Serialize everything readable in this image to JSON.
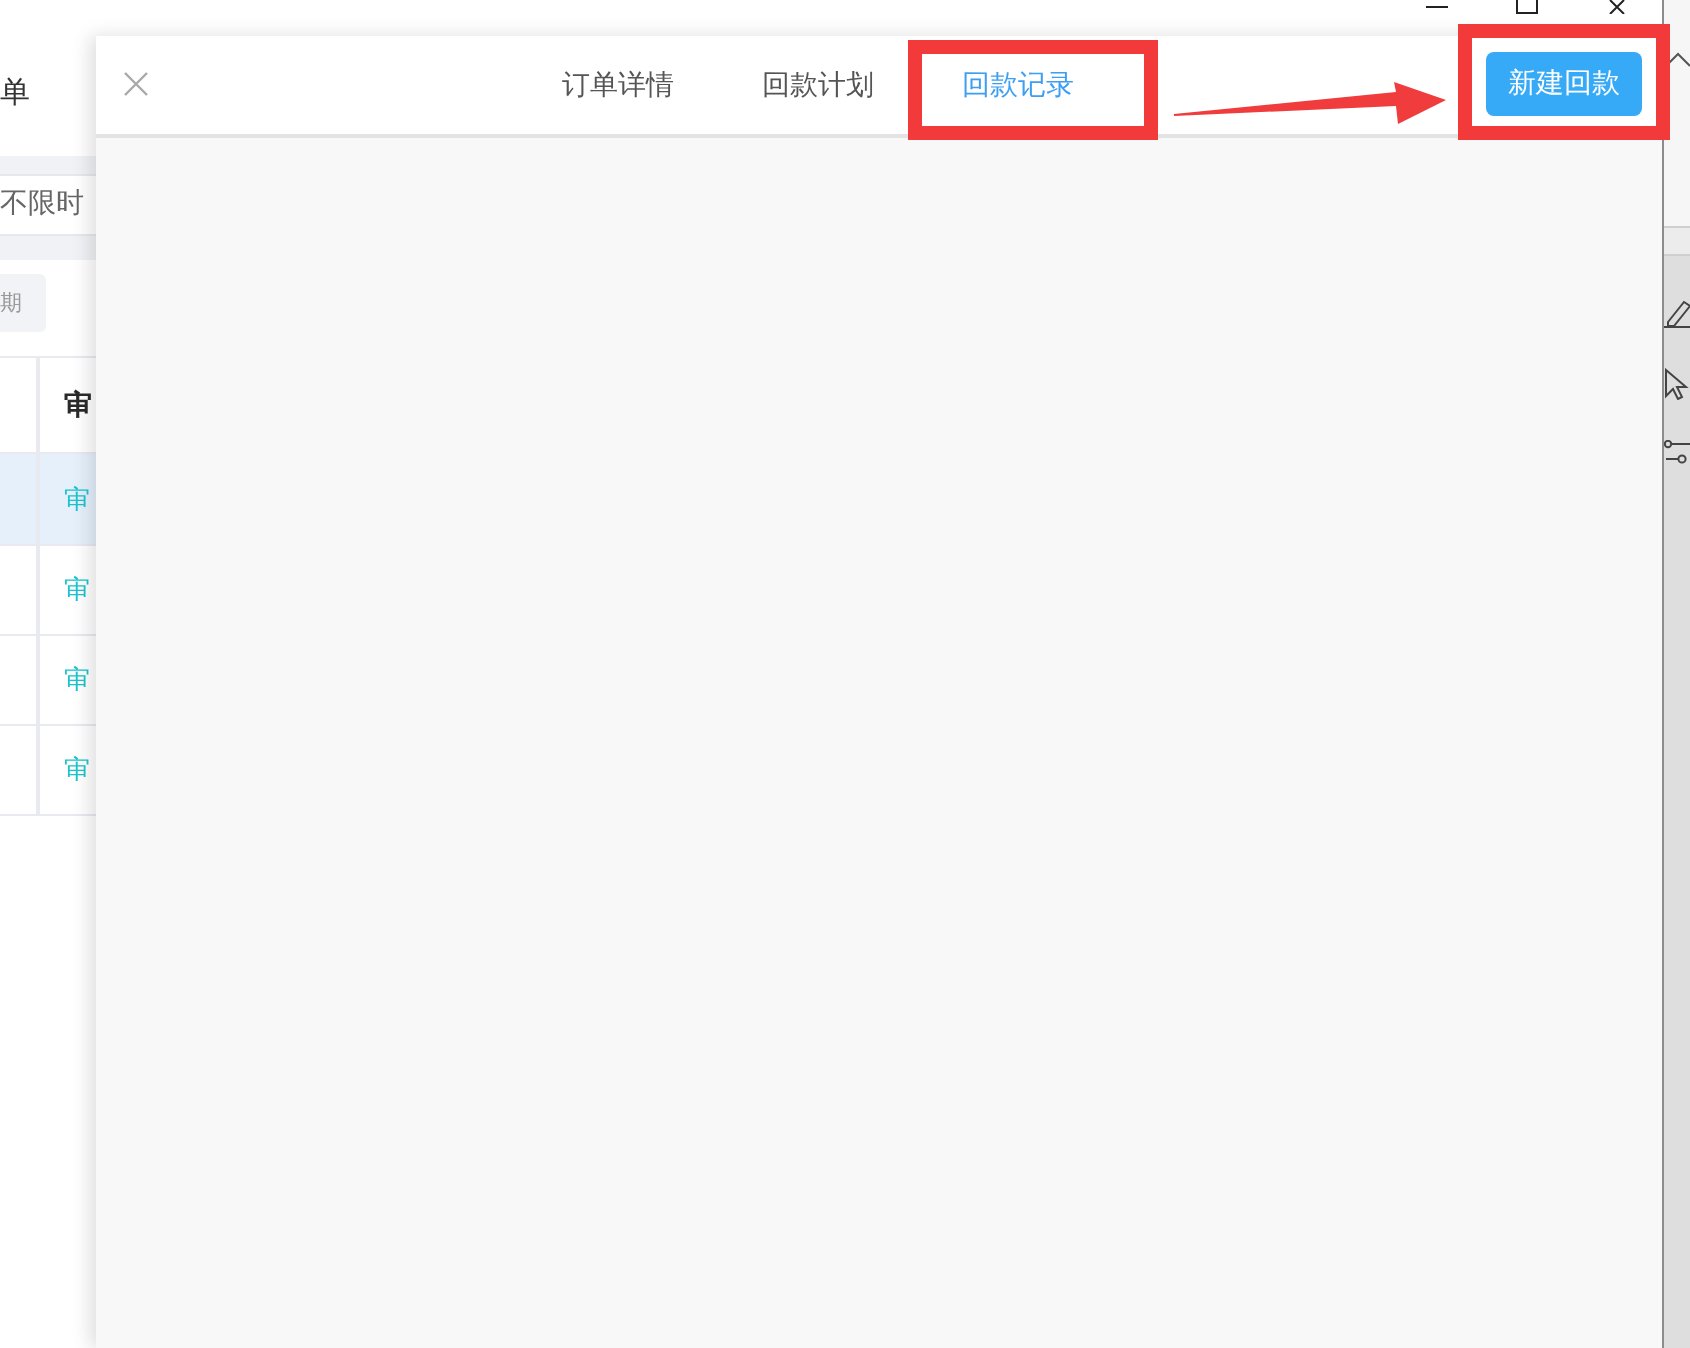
{
  "background_page": {
    "title": "单",
    "time_filter": {
      "value": "不限时"
    },
    "filter_button": {
      "label": "期"
    },
    "table": {
      "header": {
        "column_2": "审"
      },
      "rows": [
        {
          "column_2": "审",
          "selected": true
        },
        {
          "column_2": "审",
          "selected": false
        },
        {
          "column_2": "审",
          "selected": false
        },
        {
          "column_2": "审",
          "selected": false
        }
      ]
    }
  },
  "drawer": {
    "tabs": [
      {
        "label": "订单详情",
        "selected": false
      },
      {
        "label": "回款计划",
        "selected": false
      },
      {
        "label": "回款记录",
        "selected": true
      }
    ],
    "primary_action": {
      "label": "新建回款"
    }
  }
}
